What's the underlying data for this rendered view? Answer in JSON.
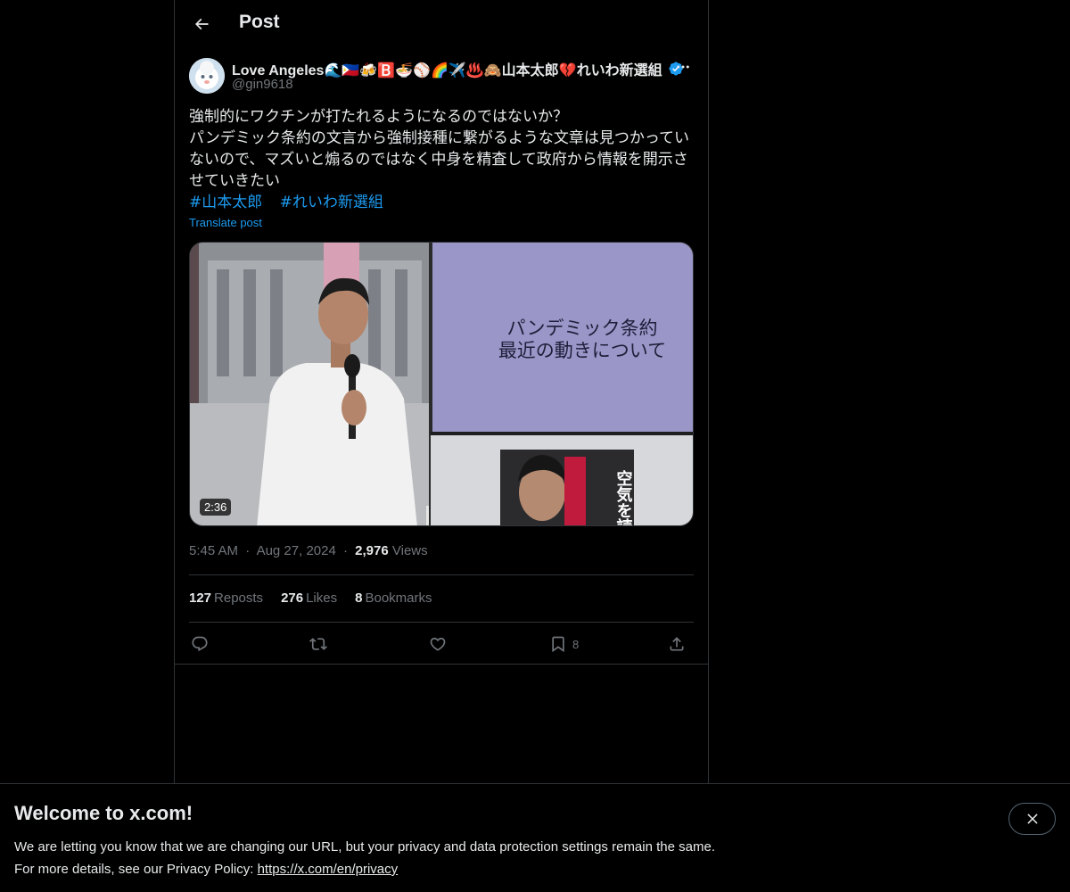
{
  "header": {
    "title": "Post"
  },
  "author": {
    "display_name": "Love Angeles🌊🇵🇭🍻🅱️🍜⚾🌈✈️♨️🙈山本太郎💔れいわ新選組",
    "handle": "@gin9618",
    "verified": true
  },
  "post": {
    "text": "強制的にワクチンが打たれるようになるのではないか？\nパンデミック条約の文言から強制接種に繋がるような文章は見つかってい\nないので、マズいと煽るのではなく中身を精査して政府から情報を開示さ\nせていきたい",
    "hashtags": [
      "#山本太郎",
      "#れいわ新選組"
    ],
    "translate_label": "Translate post"
  },
  "media": {
    "duration": "2:36",
    "slide_text": "パンデミック条約\n最近の動きについて",
    "poster_text": "空気を読\nバカにし\nこの国は\n変えられ"
  },
  "meta": {
    "time": "5:45 AM",
    "date": "Aug 27, 2024",
    "views_count": "2,976",
    "views_label": "Views",
    "separator": "·"
  },
  "stats": {
    "reposts_count": "127",
    "reposts_label": "Reposts",
    "likes_count": "276",
    "likes_label": "Likes",
    "bookmarks_count": "8",
    "bookmarks_label": "Bookmarks"
  },
  "actions": {
    "bookmark_count": "8"
  },
  "banner": {
    "title": "Welcome to x.com!",
    "line1": "We are letting you know that we are changing our URL, but your privacy and data protection settings remain the same.",
    "line2_prefix": "For more details, see our Privacy Policy: ",
    "link": "https://x.com/en/privacy"
  },
  "colors": {
    "accent": "#1d9bf0",
    "background": "#000000",
    "text": "#e7e9ea",
    "muted": "#71767b",
    "border": "#2f3336"
  },
  "icons": [
    "back-arrow-icon",
    "verified-badge-icon",
    "more-icon",
    "reply-icon",
    "repost-icon",
    "like-icon",
    "bookmark-icon",
    "share-icon",
    "close-icon"
  ]
}
